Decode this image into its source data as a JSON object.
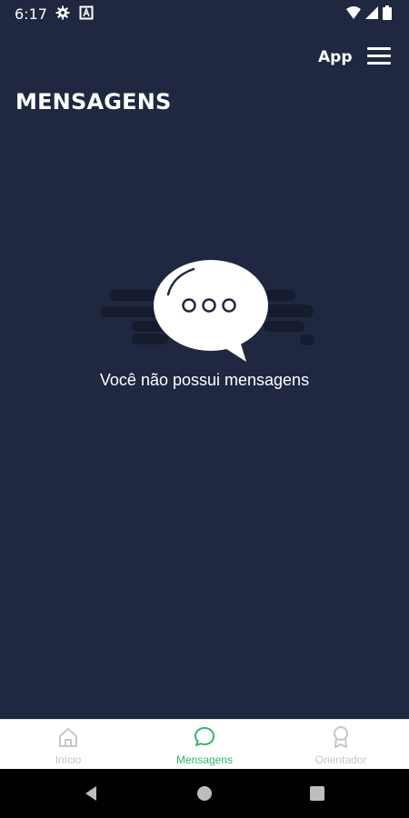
{
  "status_bar": {
    "time": "6:17",
    "left_icons": [
      "gear-icon",
      "font-a-icon"
    ],
    "right_icons": [
      "wifi-icon",
      "cellular-signal-icon",
      "battery-icon"
    ]
  },
  "header": {
    "app_label": "App",
    "menu_icon": "hamburger-menu-icon",
    "title": "MENSAGENS"
  },
  "empty_state": {
    "icon": "speech-bubble-icon",
    "message": "Você não possui mensagens"
  },
  "bottom_nav": {
    "items": [
      {
        "label": "Início",
        "icon": "home-icon",
        "active": false
      },
      {
        "label": "Mensagens",
        "icon": "chat-bubble-icon",
        "active": true
      },
      {
        "label": "Orientador",
        "icon": "award-ribbon-icon",
        "active": false
      }
    ]
  },
  "system_nav": {
    "buttons": [
      "back-triangle-icon",
      "home-circle-icon",
      "recents-square-icon"
    ]
  },
  "colors": {
    "background": "#1f2840",
    "accent_active": "#2fb866",
    "inactive": "#c7c7c7",
    "text_on_dark": "#ffffff"
  }
}
